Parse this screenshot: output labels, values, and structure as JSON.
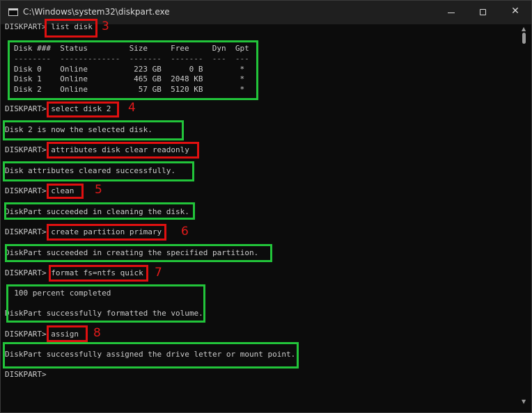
{
  "window": {
    "title": "C:\\Windows\\system32\\diskpart.exe",
    "controls": {
      "minimize": "minimize",
      "maximize": "maximize",
      "close": "✕"
    }
  },
  "console": {
    "prompt": "DISKPART> ",
    "commands": [
      "list disk",
      "select disk 2",
      "attributes disk clear readonly",
      "clean",
      "create partition primary",
      "format fs=ntfs quick",
      "assign"
    ],
    "disk_table": {
      "header": "Disk ###  Status         Size     Free     Dyn  Gpt",
      "separator": "--------  -------------  -------  -------  ---  ---",
      "rows": [
        "Disk 0    Online          223 GB      0 B        *",
        "Disk 1    Online          465 GB  2048 KB        *",
        "Disk 2    Online           57 GB  5120 KB        *"
      ]
    },
    "outputs": {
      "select": "Disk 2 is now the selected disk.",
      "attributes": "Disk attributes cleared successfully.",
      "clean": "DiskPart succeeded in cleaning the disk.",
      "create": "DiskPart succeeded in creating the specified partition.",
      "format_progress": "  100 percent completed",
      "format_done": "DiskPart successfully formatted the volume.",
      "assign": "DiskPart successfully assigned the drive letter or mount point."
    },
    "final_prompt": "DISKPART> "
  },
  "annotations": {
    "step_numbers": [
      "3",
      "4",
      "5",
      "6",
      "7",
      "8"
    ],
    "command_box_color": "#e01010",
    "output_box_color": "#22c43a"
  }
}
